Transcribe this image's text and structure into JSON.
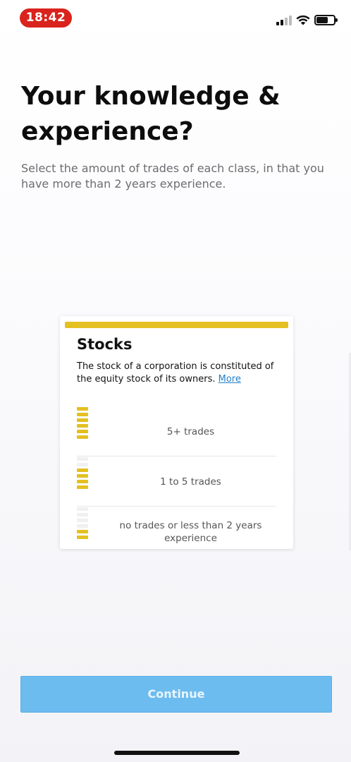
{
  "status_bar": {
    "time": "18:42",
    "icons": [
      "signal-icon",
      "wifi-icon",
      "battery-icon"
    ]
  },
  "header": {
    "title": "Your knowledge & experience?",
    "subtitle": "Select the amount of trades of each class, in that you have more than 2 years experience."
  },
  "card": {
    "title": "Stocks",
    "description": "The stock of a corporation is constituted of the equity stock of its owners.",
    "more_link": "More",
    "accent_color": "#e4c021",
    "options": [
      {
        "label": "5+ trades",
        "level": 6,
        "max_level": 6
      },
      {
        "label": "1 to 5 trades",
        "level": 4,
        "max_level": 6
      },
      {
        "label": "no trades or less than 2 years experience",
        "level": 2,
        "max_level": 6
      }
    ]
  },
  "footer": {
    "continue_label": "Continue",
    "button_color": "#6cbcf0"
  }
}
